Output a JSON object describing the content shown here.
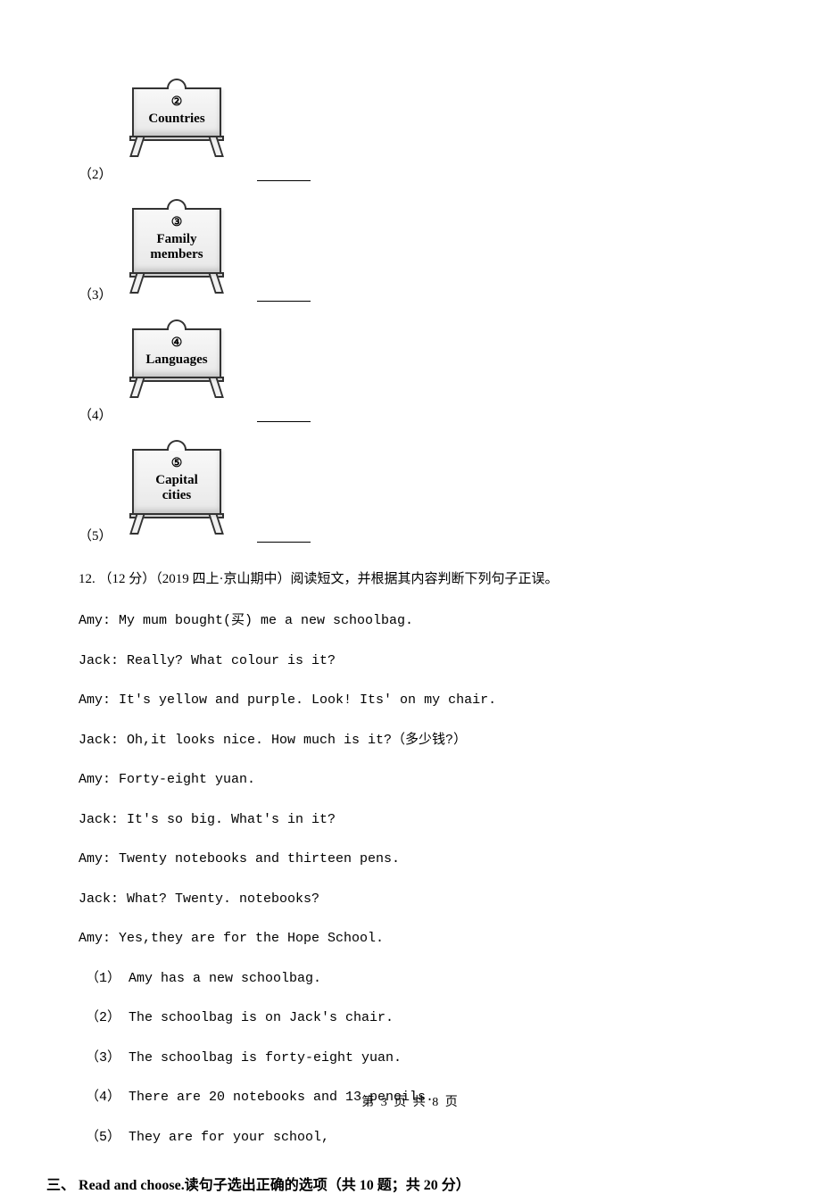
{
  "easels": [
    {
      "num_paren": "（2）",
      "circled": "②",
      "label": "Countries"
    },
    {
      "num_paren": "（3）",
      "circled": "③",
      "label": "Family\nmembers"
    },
    {
      "num_paren": "（4）",
      "circled": "④",
      "label": "Languages"
    },
    {
      "num_paren": "（5）",
      "circled": "⑤",
      "label": "Capital\ncities"
    }
  ],
  "q12": {
    "header": "12. （12 分）（2019 四上·京山期中）阅读短文，并根据其内容判断下列句子正误。",
    "lines": [
      "Amy: My mum bought(买) me a new schoolbag.",
      "Jack: Really? What colour is it?",
      "Amy: It's yellow and purple. Look! Its' on my chair.",
      "Jack: Oh,it looks nice. How much is it?（多少钱?）",
      "Amy: Forty-eight yuan.",
      "Jack: It's so big. What's in it?",
      "Amy: Twenty notebooks and thirteen pens.",
      "Jack: What? Twenty. notebooks?",
      "Amy: Yes,they are for the Hope School."
    ],
    "subs": [
      "（1） Amy has a new schoolbag.",
      "（2） The schoolbag is on Jack's chair.",
      "（3） The schoolbag is forty-eight yuan.",
      "（4） There are 20 notebooks and 13 pencils.",
      "（5） They are for your school,"
    ]
  },
  "section3": {
    "num": "三、",
    "title": " Read and choose.读句子选出正确的选项（共 10 题；共 20 分）"
  },
  "footer": "第 3 页 共 8 页"
}
